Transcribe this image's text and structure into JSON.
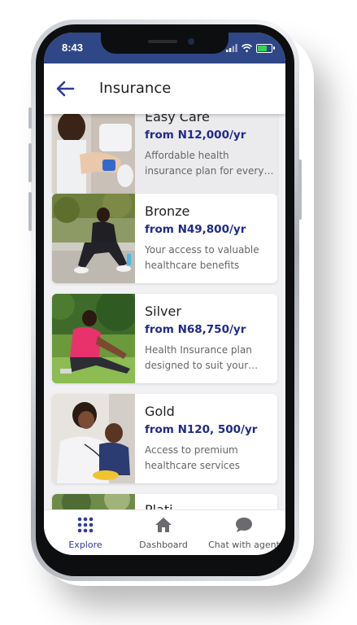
{
  "status": {
    "time": "8:43"
  },
  "header": {
    "title": "Insurance",
    "back_icon": "arrow-left-icon"
  },
  "plans": [
    {
      "name": "Easy Care",
      "price": "from N12,000/yr",
      "description": "Affordable health insurance plan for every pocket"
    },
    {
      "name": "Bronze",
      "price": "from N49,800/yr",
      "description": "Your access to valuable healthcare benefits"
    },
    {
      "name": "Silver",
      "price": "from N68,750/yr",
      "description": "Health Insurance plan designed to suit your…"
    },
    {
      "name": "Gold",
      "price": "from N120, 500/yr",
      "description": "Access to premium healthcare services"
    },
    {
      "name": "Plati",
      "price": "",
      "description": ""
    }
  ],
  "nav": {
    "items": [
      {
        "label": "Explore",
        "icon": "grid-dots-icon",
        "active": true
      },
      {
        "label": "Dashboard",
        "icon": "home-icon",
        "active": false
      },
      {
        "label": "Chat with agent",
        "icon": "chat-bubble-icon",
        "active": false
      }
    ]
  },
  "colors": {
    "status_bar": "#2f4787",
    "accent": "#1f2a8a",
    "nav_active": "#2f3aa0"
  }
}
